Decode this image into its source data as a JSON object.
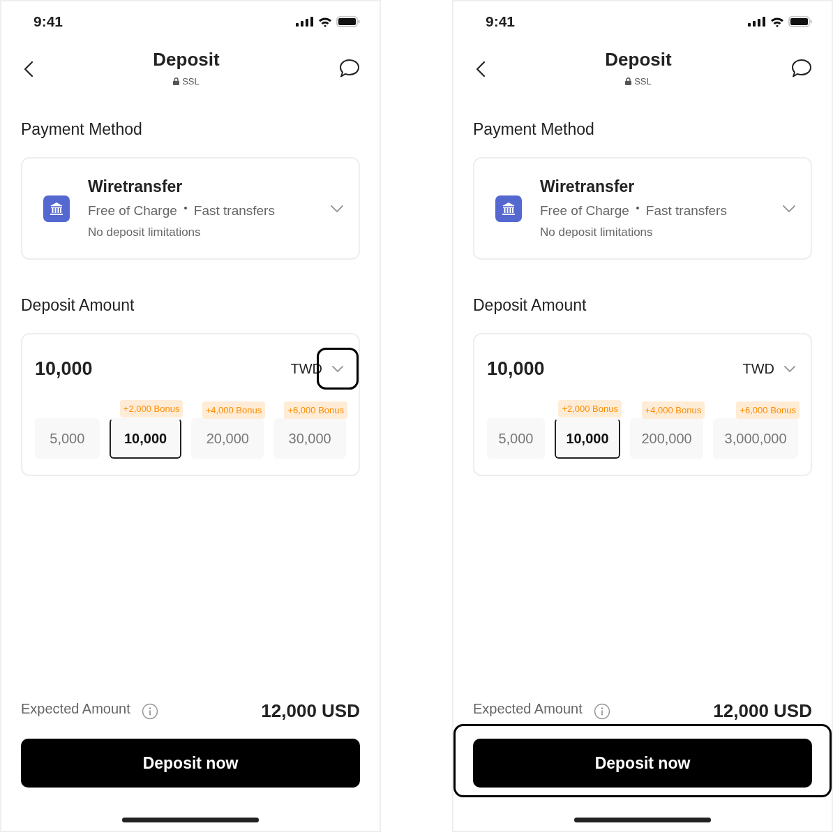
{
  "screens": [
    {
      "time": "9:41",
      "title": "Deposit",
      "security_label": "SSL",
      "payment_section_title": "Payment Method",
      "method": {
        "name": "Wiretransfer",
        "features": [
          "Free of Charge",
          "Fast transfers"
        ],
        "note": "No deposit limitations"
      },
      "amount_section_title": "Deposit Amount",
      "amount": "10,000",
      "currency": "TWD",
      "presets": [
        {
          "amount": "5,000",
          "selected": false
        },
        {
          "amount": "10,000",
          "bonus": "+2,000 Bonus",
          "selected": true
        },
        {
          "amount": "20,000",
          "bonus": "+4,000 Bonus",
          "selected": false
        },
        {
          "amount": "30,000",
          "bonus": "+6,000 Bonus",
          "selected": false
        }
      ],
      "expected_label": "Expected Amount",
      "expected_value": "12,000 USD",
      "button": "Deposit now",
      "currency_highlighted": true,
      "button_highlighted": false
    },
    {
      "time": "9:41",
      "title": "Deposit",
      "security_label": "SSL",
      "payment_section_title": "Payment Method",
      "method": {
        "name": "Wiretransfer",
        "features": [
          "Free of Charge",
          "Fast transfers"
        ],
        "note": "No deposit limitations"
      },
      "amount_section_title": "Deposit Amount",
      "amount": "10,000",
      "currency": "TWD",
      "presets": [
        {
          "amount": "5,000",
          "selected": false
        },
        {
          "amount": "10,000",
          "bonus": "+2,000 Bonus",
          "selected": true
        },
        {
          "amount": "200,000",
          "bonus": "+4,000 Bonus",
          "selected": false
        },
        {
          "amount": "3,000,000",
          "bonus": "+6,000 Bonus",
          "selected": false
        }
      ],
      "expected_label": "Expected Amount",
      "expected_value": "12,000 USD",
      "button": "Deposit now",
      "currency_highlighted": false,
      "button_highlighted": true
    }
  ]
}
